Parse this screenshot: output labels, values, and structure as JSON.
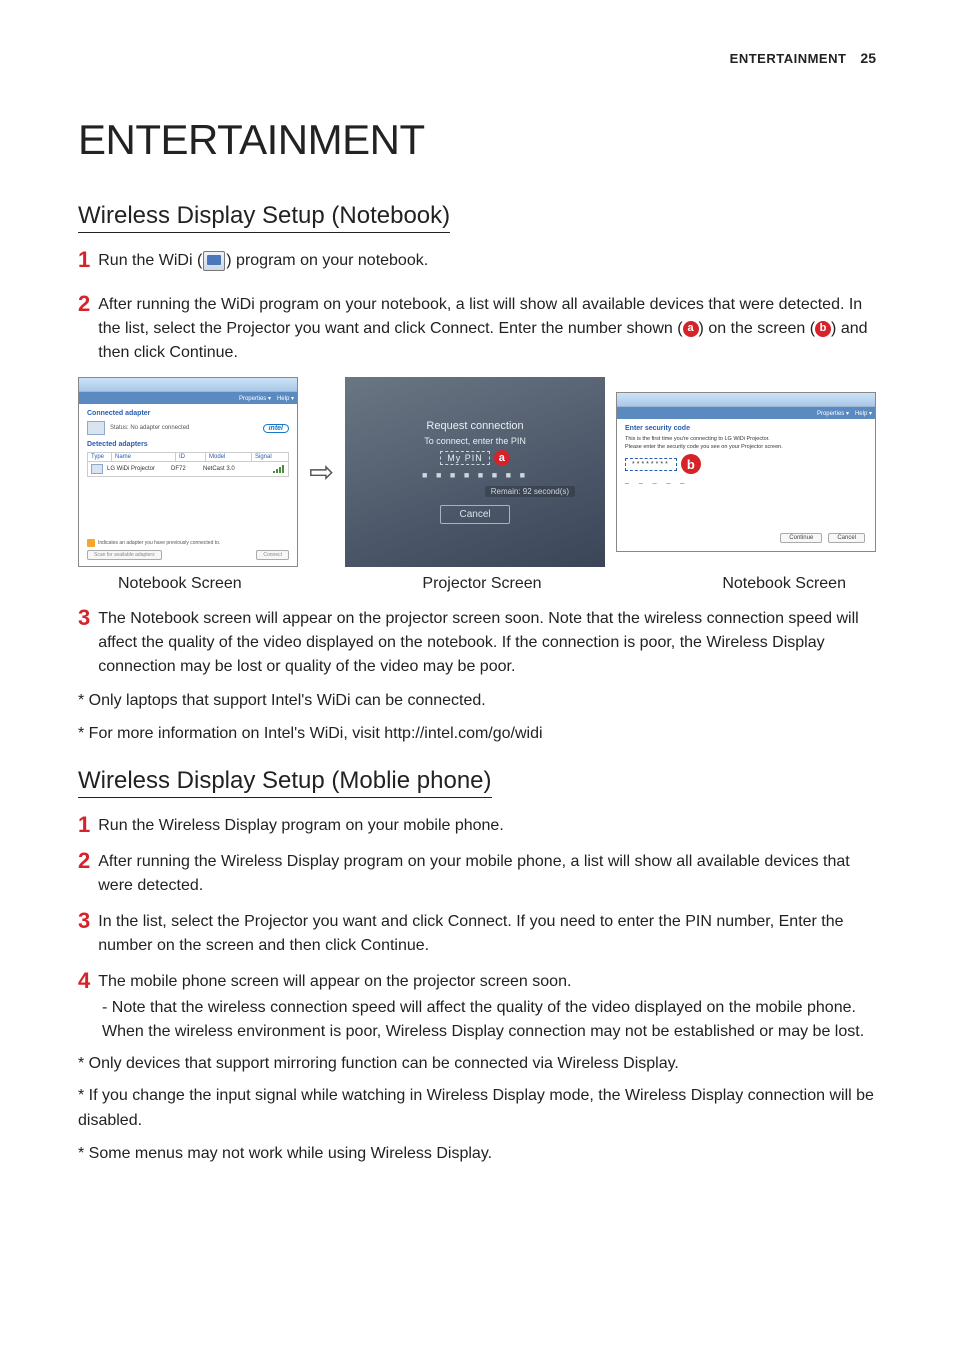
{
  "header": {
    "title": "ENTERTAINMENT",
    "page": "25"
  },
  "main_title": "ENTERTAINMENT",
  "section1": {
    "title": "Wireless Display Setup (Notebook)",
    "step1_pre": "Run the WiDi (",
    "step1_post": ") program on your notebook.",
    "step2_a": "After running the WiDi program on your notebook, a list will show all available devices that were detected. In the list, select the Projector you want and click Connect. Enter the number shown (",
    "step2_b": ") on the screen (",
    "step2_c": ") and then click Continue.",
    "step3": "The Notebook screen will appear on the projector screen soon. Note that the wireless connection speed will affect the quality of the video displayed on the notebook. If the connection is poor, the Wireless Display connection may be lost or quality of the video may be poor.",
    "star1": "* Only laptops that support Intel's WiDi can be connected.",
    "star2": "* For more information on Intel's WiDi, visit http://intel.com/go/widi"
  },
  "captions": {
    "left": "Notebook Screen",
    "mid": "Projector Screen",
    "right": "Notebook Screen"
  },
  "panel_left": {
    "menu_prop": "Properties ▾",
    "menu_help": "Help ▾",
    "conn": "Connected adapter",
    "status": "Status: No adapter connected",
    "intel": "intel",
    "detected": "Detected adapters",
    "th_type": "Type",
    "th_name": "Name",
    "th_id": "ID",
    "th_model": "Model",
    "th_signal": "Signal",
    "row_name": "LG WiDi Projector",
    "row_id": "DF72",
    "row_model": "NetCast 3.0",
    "warn": "Indicates an adapter you have previously connected to.",
    "scan": "Scan for available adapters",
    "connect": "Connect"
  },
  "proj": {
    "req": "Request connection",
    "sub": "To connect, enter the PIN",
    "pin": "My PIN",
    "dashes": "■ ■ ■ ■ ■ ■ ■ ■",
    "remain": "Remain: 92 second(s)",
    "cancel": "Cancel"
  },
  "panel_right": {
    "menu_prop": "Properties ▾",
    "menu_help": "Help ▾",
    "title": "Enter security code",
    "line1": "This is the first time you're connecting to LG WiDi Projector.",
    "line2": "Please enter the security code you see on your Projector screen.",
    "code": "********",
    "dashes": "_ _ _ _ _",
    "continue": "Continue",
    "cancel": "Cancel"
  },
  "labels": {
    "a": "a",
    "b": "b"
  },
  "nums": {
    "n1": "1",
    "n2": "2",
    "n3": "3",
    "n4": "4"
  },
  "section2": {
    "title": "Wireless Display Setup (Moblie phone)",
    "step1": "Run the Wireless Display program on your mobile phone.",
    "step2": "After running the Wireless Display program on your mobile phone, a list will show all available devices that were detected.",
    "step3": "In the list, select the Projector you want and click Connect. If you need to enter the PIN number, Enter the number on the screen and then click Continue.",
    "step4": "The mobile phone screen will appear on the projector screen soon.",
    "sub4": "- Note that the wireless connection speed will affect the quality of the video displayed on the mobile phone. When the wireless environment is poor, Wireless Display connection may not be established or may be lost.",
    "star1": "* Only devices that support mirroring function can be connected via Wireless Display.",
    "star2": "* If you change the input signal while watching in Wireless Display mode, the Wireless Display connection will be disabled.",
    "star3": "* Some menus may not work while using Wireless Display."
  }
}
